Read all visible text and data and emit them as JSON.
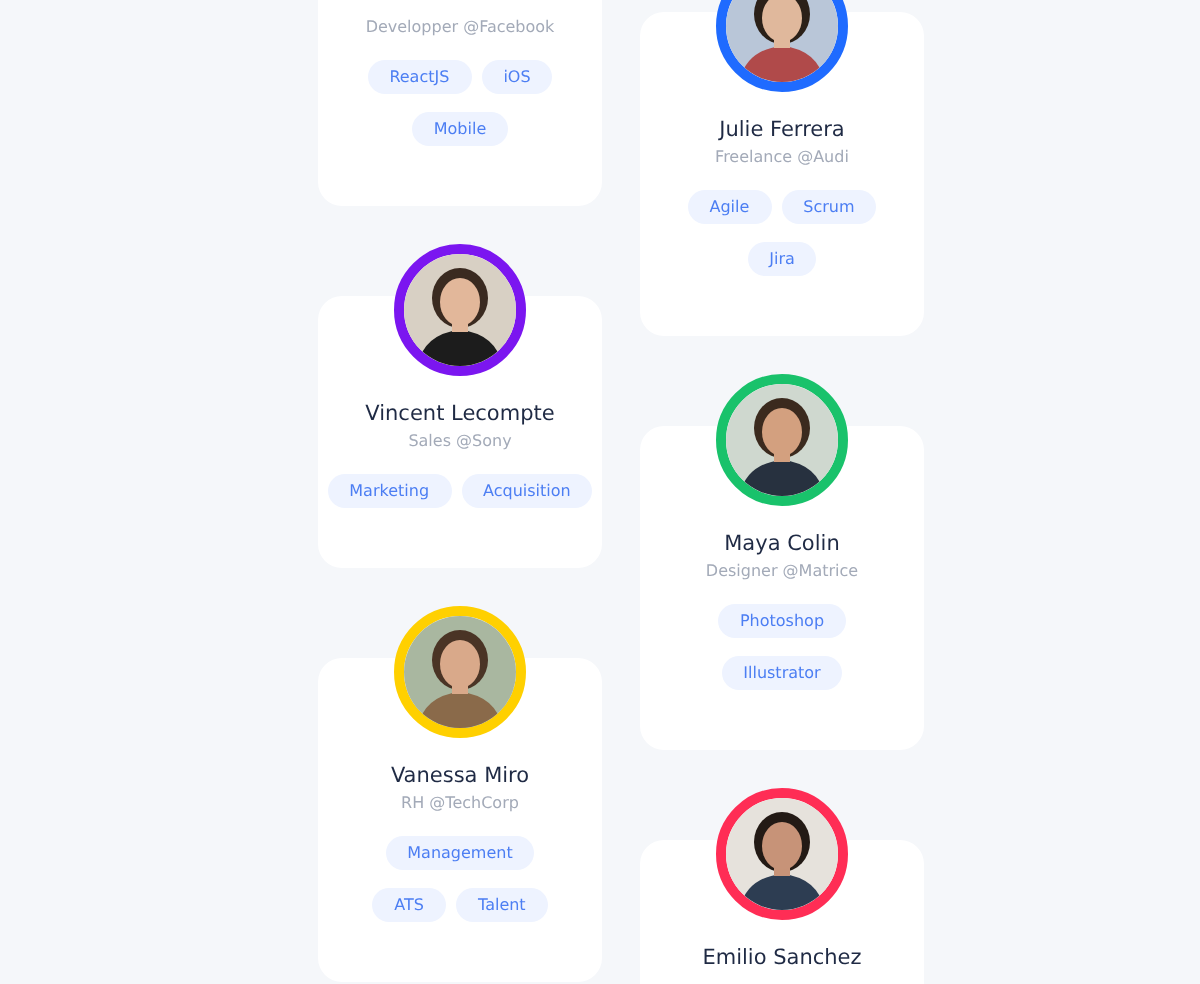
{
  "columns": [
    {
      "cards": [
        {
          "role": "Developper @Facebook",
          "tag_rows": [
            [
              "ReactJS",
              "iOS"
            ],
            [
              "Mobile"
            ]
          ]
        },
        {
          "avatar": {
            "kind": "picture",
            "color": "#7b16f0"
          },
          "name": "Vincent Lecompte",
          "role": "Sales @Sony",
          "tag_rows": [
            [
              "Marketing",
              "Acquisition"
            ]
          ]
        },
        {
          "avatar": {
            "kind": "picture",
            "color": "#ffd000"
          },
          "name": "Vanessa Miro",
          "role": "RH @TechCorp",
          "tag_rows": [
            [
              "Management"
            ],
            [
              "ATS",
              "Talent"
            ]
          ]
        }
      ]
    },
    {
      "cards": [
        {
          "avatar": {
            "kind": "picture",
            "color": "#1f6bff"
          },
          "name": "Julie Ferrera",
          "role": "Freelance @Audi",
          "tag_rows": [
            [
              "Agile",
              "Scrum"
            ],
            [
              "Jira"
            ]
          ]
        },
        {
          "avatar": {
            "kind": "picture",
            "color": "#19c26b"
          },
          "name": "Maya Colin",
          "role": "Designer @Matrice",
          "tag_rows": [
            [
              "Photoshop"
            ],
            [
              "Illustrator"
            ]
          ]
        },
        {
          "avatar": {
            "kind": "picture",
            "color": "#ff2d55"
          },
          "name": "Emilio Sanchez"
        }
      ]
    }
  ]
}
